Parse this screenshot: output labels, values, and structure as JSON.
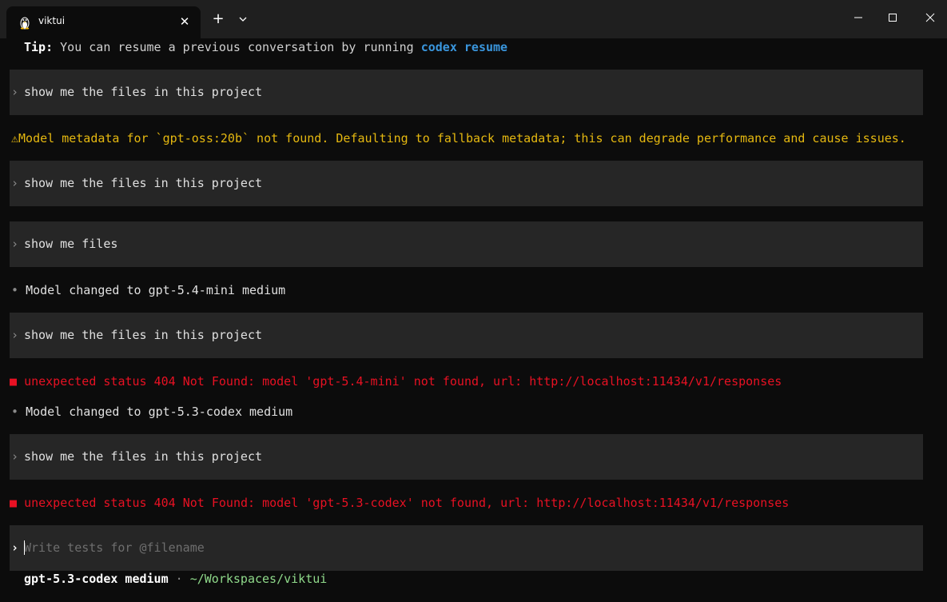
{
  "window": {
    "tab_title": "viktui",
    "tab_icon": "linux-penguin-icon",
    "new_tab_label": "+",
    "close_tab_label": "✕"
  },
  "tip": {
    "label": "Tip:",
    "text": " You can resume a previous conversation by running ",
    "command_1": "codex",
    "command_2": "resume"
  },
  "transcript": {
    "prompt_marker": "›",
    "bullet_marker": "•",
    "error_marker": "■",
    "warn_icon": "⚠",
    "user_1": "show me the files in this project",
    "warning": "Model metadata for `gpt-oss:20b` not found. Defaulting to fallback metadata; this can degrade performance and cause issues.",
    "user_2": "show me the files in this project",
    "user_3": "show me files",
    "info_1": "Model changed to gpt-5.4-mini medium",
    "user_4": "show me the files in this project",
    "error_1": "unexpected status 404 Not Found: model 'gpt-5.4-mini' not found, url: http://localhost:11434/v1/responses",
    "info_2": "Model changed to gpt-5.3-codex medium",
    "user_5": "show me the files in this project",
    "error_2": "unexpected status 404 Not Found: model 'gpt-5.3-codex' not found, url: http://localhost:11434/v1/responses"
  },
  "composer": {
    "placeholder": "Write tests for @filename"
  },
  "status_bar": {
    "model": "gpt-5.3-codex medium",
    "separator": "·",
    "path": "~/Workspaces/viktui"
  },
  "colors": {
    "background": "#0c0c0c",
    "block": "#262626",
    "accent_blue": "#3a96dd",
    "warning": "#e5b810",
    "error": "#e81123",
    "path_green": "#8fd98a"
  }
}
